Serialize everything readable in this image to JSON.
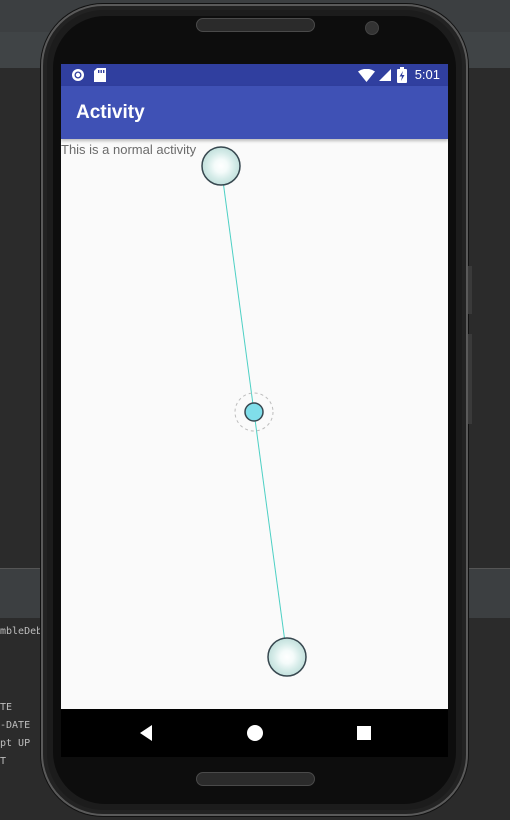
{
  "ide": {
    "console_lines": [
      "mbleDeb",
      "TE",
      "-DATE",
      "pt UP",
      "T"
    ]
  },
  "status_bar": {
    "left_icons": [
      "record-icon",
      "sd-card-icon"
    ],
    "right_icons": [
      "wifi-icon",
      "signal-icon",
      "battery-icon"
    ],
    "time": "5:01"
  },
  "app_bar": {
    "title": "Activity"
  },
  "content": {
    "text": "This is a normal activity"
  },
  "overlay_colors": {
    "line": "#4dd0c4",
    "handle_fill": "#e0f2f1",
    "handle_stroke": "#37474f",
    "center_fill": "#80deea"
  },
  "nav_bar": {
    "buttons": [
      "back-icon",
      "home-icon",
      "recents-icon"
    ]
  }
}
